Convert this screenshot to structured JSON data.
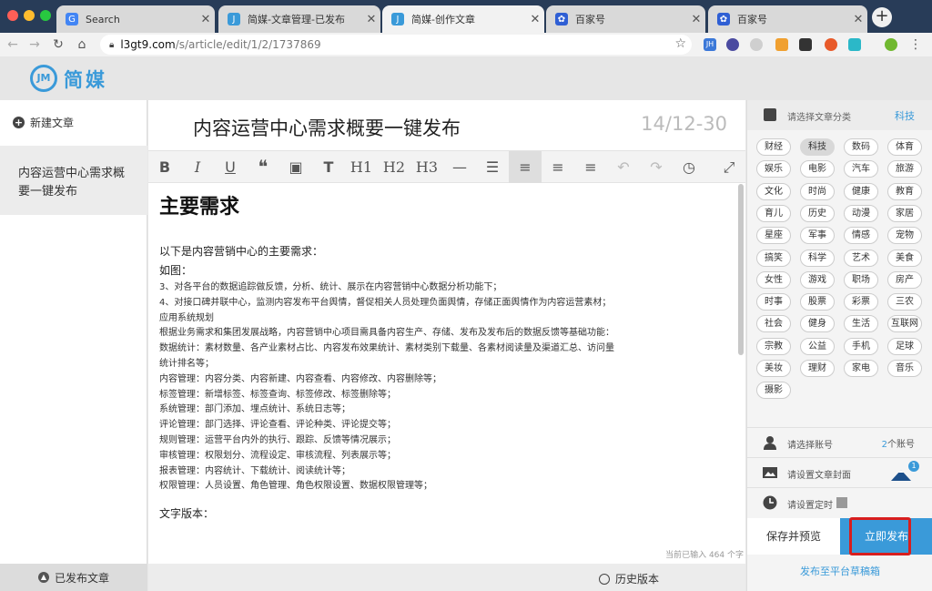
{
  "browser": {
    "tabs": [
      {
        "title": "Search",
        "active": false
      },
      {
        "title": "简媒-文章管理-已发布",
        "active": false
      },
      {
        "title": "简媒-创作文章",
        "active": true
      },
      {
        "title": "百家号",
        "active": false
      },
      {
        "title": "百家号",
        "active": false
      }
    ],
    "new_tab": "+",
    "url_host": "l3gt9.com",
    "url_path": "/s/article/edit/1/2/1737869",
    "extensions": [
      "JH"
    ]
  },
  "app": {
    "logo_mark": "JM",
    "logo_text": "简媒",
    "brand_color": "#3a9ad9"
  },
  "sidebar": {
    "new_article": "新建文章",
    "current_article": "内容运营中心需求概要一键发布",
    "published_articles": "已发布文章"
  },
  "editor": {
    "title": "内容运营中心需求概要一键发布",
    "title_counter": "14/12-30",
    "toolbar": {
      "bold": "B",
      "italic": "I",
      "underline": "U",
      "quote": "❝",
      "image": "▣",
      "text": "T",
      "h1": "H1",
      "h2": "H2",
      "h3": "H3",
      "hr": "—",
      "list": "☰",
      "align_left": "≡",
      "align_center": "≡",
      "align_right": "≡",
      "undo": "↶",
      "redo": "↷",
      "history": "◷",
      "fullscreen": "⤢"
    },
    "heading": "主要需求",
    "intro": "以下是内容营销中心的主要需求：",
    "figure_label": "如图：",
    "lines": [
      "3、对各平台的数据追踪做反馈，分析、统计、展示在内容营销中心数据分析功能下；",
      "4、对接口碑并联中心，监测内容发布平台舆情，督促相关人员处理负面舆情，存储正面舆情作为内容运营素材；",
      "应用系统规划",
      "根据业务需求和集团发展战略，内容营销中心项目需具备内容生产、存储、发布及发布后的数据反馈等基础功能：",
      "数据统计：素材数量、各产业素材占比、内容发布效果统计、素材类别下载量、各素材阅读量及渠道汇总、访问量",
      "统计排名等；",
      "内容管理：内容分类、内容新建、内容查看、内容修改、内容删除等；",
      "标签管理：新增标签、标签查询、标签修改、标签删除等；",
      "系统管理：部门添加、埋点统计、系统日志等；",
      "评论管理：部门选择、评论查看、评论种类、评论提交等；",
      "规则管理：运营平台内外的执行、跟踪、反馈等情况展示；",
      "审核管理：权限划分、流程设定、审核流程、列表展示等；",
      "报表管理：内容统计、下载统计、阅读统计等；",
      "权限管理：人员设置、角色管理、角色权限设置、数据权限管理等；"
    ],
    "section2": "文字版本：",
    "word_count": "当前已输入 464 个字",
    "history_version": "历史版本"
  },
  "right_panel": {
    "category_label": "请选择文章分类",
    "category_value": "科技",
    "categories": [
      "财经",
      "科技",
      "数码",
      "体育",
      "娱乐",
      "电影",
      "汽车",
      "旅游",
      "文化",
      "时尚",
      "健康",
      "教育",
      "育儿",
      "历史",
      "动漫",
      "家居",
      "星座",
      "军事",
      "情感",
      "宠物",
      "搞笑",
      "科学",
      "艺术",
      "美食",
      "女性",
      "游戏",
      "职场",
      "房产",
      "时事",
      "股票",
      "彩票",
      "三农",
      "社会",
      "健身",
      "生活",
      "互联网",
      "宗教",
      "公益",
      "手机",
      "足球",
      "美妆",
      "理财",
      "家电",
      "音乐",
      "摄影"
    ],
    "selected_category": "科技",
    "account_label": "请选择账号",
    "account_count": "2",
    "account_suffix": "个账号",
    "cover_label": "请设置文章封面",
    "cover_badge": "1",
    "schedule_label": "请设置定时",
    "save_preview": "保存并预览",
    "publish_now": "立即发布",
    "publish_draft": "发布至平台草稿箱"
  }
}
